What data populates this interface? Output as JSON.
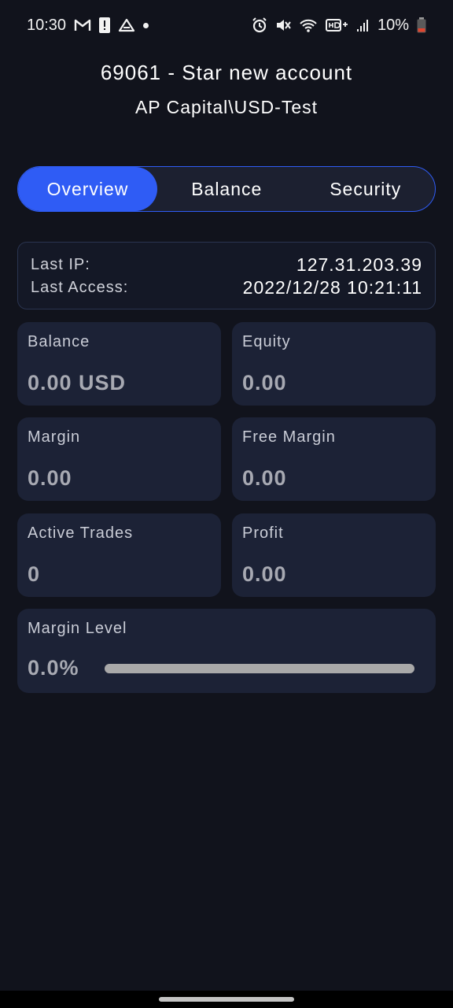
{
  "status_bar": {
    "time": "10:30",
    "battery": "10%",
    "left_icons": [
      "gmail-icon",
      "alert-icon",
      "drive-icon",
      "dot-icon"
    ],
    "right_icons": [
      "alarm-icon",
      "mute-icon",
      "wifi-icon",
      "hd-icon",
      "signal-icon",
      "battery-icon"
    ]
  },
  "header": {
    "title": "69061 - Star new account",
    "server": "AP Capital\\USD-Test"
  },
  "tabs": [
    {
      "label": "Overview",
      "active": true
    },
    {
      "label": "Balance",
      "active": false
    },
    {
      "label": "Security",
      "active": false
    }
  ],
  "access": {
    "ip_label": "Last IP:",
    "ip_value": "127.31.203.39",
    "access_label": "Last Access:",
    "access_value": "2022/12/28 10:21:11"
  },
  "stats": {
    "balance": {
      "label": "Balance",
      "value": "0.00 USD"
    },
    "equity": {
      "label": "Equity",
      "value": "0.00"
    },
    "margin": {
      "label": "Margin",
      "value": "0.00"
    },
    "free_margin": {
      "label": "Free Margin",
      "value": "0.00"
    },
    "active_trades": {
      "label": "Active Trades",
      "value": "0"
    },
    "profit": {
      "label": "Profit",
      "value": "0.00"
    },
    "margin_level": {
      "label": "Margin Level",
      "value": "0.0%",
      "progress_fraction": 0.0
    }
  },
  "colors": {
    "accent": "#2f5cf5",
    "background": "#11131c",
    "card": "#1c2236"
  }
}
